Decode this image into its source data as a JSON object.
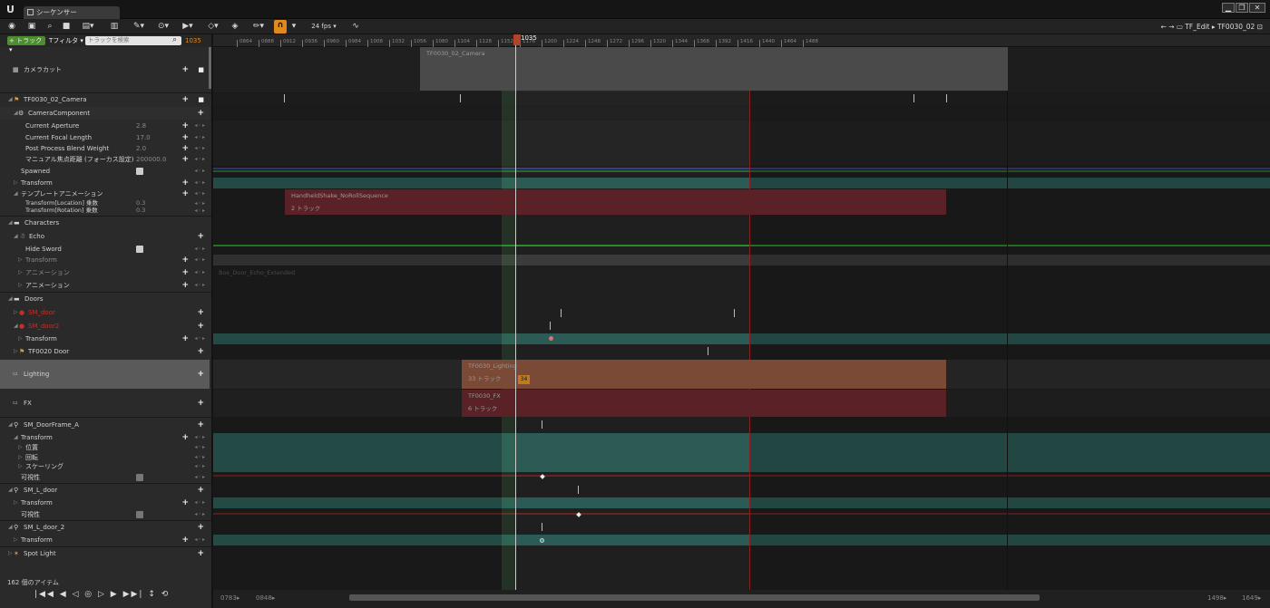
{
  "window": {
    "tab_title": "シーケンサー",
    "min": "▁",
    "max": "❐",
    "close": "✕"
  },
  "toolbar": {
    "fps": "24 fps",
    "breadcrumb_parent": "TF_Edit",
    "breadcrumb_current": "TF0030_02"
  },
  "filterbar": {
    "add_track": "+ トラック ▾",
    "filter": "Tフィルタ ▾",
    "search_placeholder": "トラックを検索",
    "frame": "1035"
  },
  "tree": [
    {
      "label": "カメラカット"
    },
    {
      "label": "TF0030_02_Camera"
    },
    {
      "label": "CameraComponent"
    },
    {
      "label": "Current Aperture",
      "value": "2.8"
    },
    {
      "label": "Current Focal Length",
      "value": "17.0"
    },
    {
      "label": "Post Process Blend Weight",
      "value": "2.0"
    },
    {
      "label": "マニュアル焦点距離 (フォーカス設定)",
      "value": "200000.0"
    },
    {
      "label": "Spawned"
    },
    {
      "label": "Transform"
    },
    {
      "label": "テンプレートアニメーション"
    },
    {
      "label": "Transform[Location] 乗数",
      "value": "0.3"
    },
    {
      "label": "Transform[Rotation] 乗数",
      "value": "0.3"
    },
    {
      "label": "Characters"
    },
    {
      "label": "Echo"
    },
    {
      "label": "Hide Sword"
    },
    {
      "label": "Transform"
    },
    {
      "label": "アニメーション"
    },
    {
      "label": "アニメーション"
    },
    {
      "label": "Doors"
    },
    {
      "label": "SM_door"
    },
    {
      "label": "SM_door2"
    },
    {
      "label": "Transform"
    },
    {
      "label": "TF0020 Door"
    },
    {
      "label": "Lighting"
    },
    {
      "label": "FX"
    },
    {
      "label": "SM_DoorFrame_A"
    },
    {
      "label": "Transform"
    },
    {
      "label": "位置"
    },
    {
      "label": "回転"
    },
    {
      "label": "スケーリング"
    },
    {
      "label": "可視性"
    },
    {
      "label": "SM_L_door"
    },
    {
      "label": "Transform"
    },
    {
      "label": "可視性"
    },
    {
      "label": "SM_L_door_2"
    },
    {
      "label": "Transform"
    },
    {
      "label": "Spot Light"
    }
  ],
  "footer": {
    "item_count": "162 個のアイテム",
    "transport": "|◀◀ ◀ ◁ ◎ ▷ ▶ ▶▶| ↕ ⟲"
  },
  "ruler": {
    "playhead": "1035",
    "ticks": [
      "0864",
      "0888",
      "0912",
      "0936",
      "0960",
      "0984",
      "1008",
      "1032",
      "1056",
      "1080",
      "1104",
      "1128",
      "1152",
      "1176",
      "1200",
      "1224",
      "1248",
      "1272",
      "1296",
      "1320",
      "1344",
      "1368",
      "1392",
      "1416",
      "1440",
      "1464",
      "1488"
    ]
  },
  "sections": {
    "camera": "TF0030_02_Camera",
    "handheld": "HandheldShake_NoRollSequence",
    "handheld_sub": "2 トラック",
    "anim": "Box_Door_Echo_Extended",
    "lighting": "TF0030_Lighting",
    "lighting_sub": "33 トラック",
    "lighting_badge": "34",
    "fx": "TF0030_FX",
    "fx_sub": "6 トラック"
  },
  "bottom": {
    "start_left": "0783▸",
    "start_right": "0848▸",
    "end_left": "1498▸",
    "end_right": "1649▸"
  }
}
